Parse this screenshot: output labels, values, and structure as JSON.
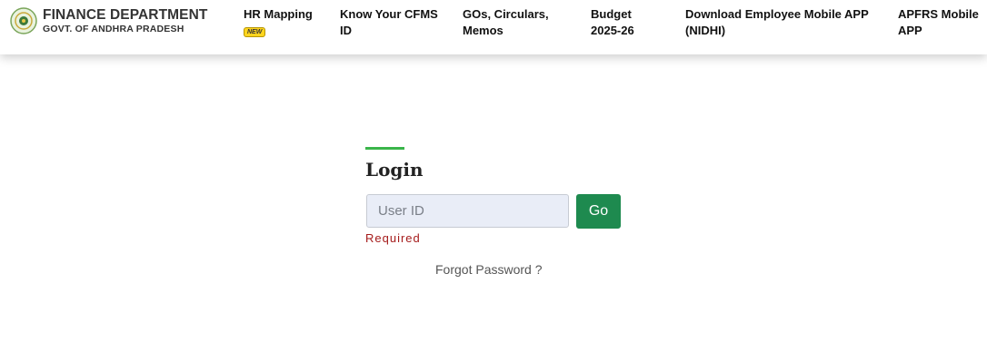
{
  "brand": {
    "title": "FINANCE DEPARTMENT",
    "subtitle": "GOVT. OF ANDHRA PRADESH",
    "emblem_icon": "ap-emblem-icon"
  },
  "nav": {
    "items": [
      {
        "line1": "HR Mapping",
        "line2": ""
      },
      {
        "line1": "Know Your CFMS",
        "line2": "ID"
      },
      {
        "line1": "GOs, Circulars,",
        "line2": "Memos"
      },
      {
        "line1": "Budget",
        "line2": "2025-26"
      },
      {
        "line1": "Download Employee Mobile APP",
        "line2": "(NIDHI)"
      },
      {
        "line1": "APFRS Mobile",
        "line2": "APP"
      }
    ],
    "new_badge": "NEW"
  },
  "login": {
    "title": "Login",
    "userid_placeholder": "User ID",
    "userid_value": "",
    "go_label": "Go",
    "validation_message": "Required",
    "forgot_label": "Forgot Password ?"
  },
  "colors": {
    "accent_green": "#3ab54a",
    "button_green": "#1e8a4f",
    "error_red": "#a51b1b",
    "input_bg": "#e9edf7"
  }
}
